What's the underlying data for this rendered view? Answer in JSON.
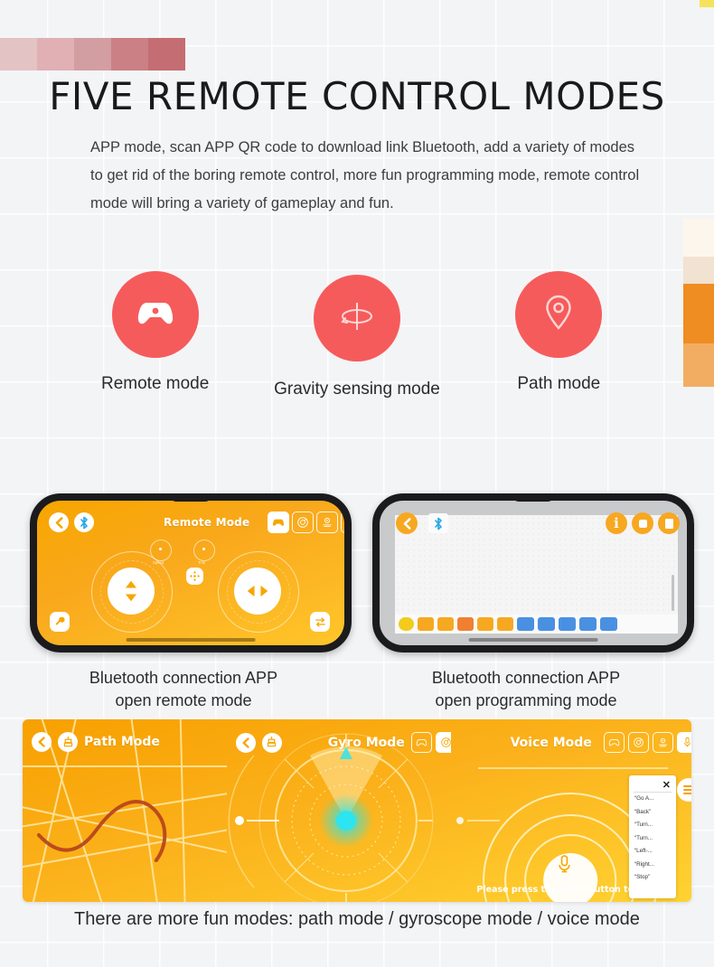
{
  "page": {
    "heading": "FIVE REMOTE CONTROL MODES",
    "lead_paragraph": "APP mode, scan APP QR code to download link Bluetooth, add a variety of modes to get rid of the boring remote control, more fun programming mode, remote control mode will bring a variety of gameplay and fun.",
    "bottom_caption": "There are more fun modes: path mode / gyroscope mode / voice mode"
  },
  "decor": {
    "top_bar_colors": [
      "#e3c3c4",
      "#e0b0b4",
      "#d39ea1",
      "#ca8084",
      "#c46d72"
    ],
    "right_swatch_colors": [
      "#fdf6ec",
      "#f2e2d2",
      "#f0e1cf",
      "#ef8c22",
      "#f2ad63"
    ],
    "corner_marker_color": "#f5e25a",
    "accent_red": "#f65b5b",
    "accent_orange": "#f7a600",
    "accent_yellow": "#ffd232"
  },
  "modes": [
    {
      "icon": "gamepad-icon",
      "label": "Remote mode"
    },
    {
      "icon": "gyroscope-icon",
      "label": "Gravity sensing mode"
    },
    {
      "icon": "map-pin-icon",
      "label": "Path mode"
    }
  ],
  "phones": [
    {
      "id": "remote",
      "caption_line1": "Bluetooth connection APP",
      "caption_line2": "open remote mode",
      "screen": {
        "title": "Remote Mode",
        "back_icon": "chevron-left-icon",
        "bluetooth_icon": "bluetooth-icon",
        "mode_chips": [
          {
            "icon": "gamepad-icon",
            "selected": true
          },
          {
            "icon": "gyroscope-icon",
            "selected": false
          },
          {
            "icon": "path-icon",
            "selected": false
          },
          {
            "icon": "microphone-icon",
            "selected": false
          }
        ],
        "knob_left_label": "Speed",
        "knob_right_label": "Trim",
        "center_button_icon": "four-way-arrow-icon",
        "left_joystick_icon": "up-down-arrow-icon",
        "right_joystick_icon": "left-right-arrow-icon",
        "tool_button_icon": "wrench-icon",
        "swap_button_icon": "swap-arrows-icon"
      }
    },
    {
      "id": "programming",
      "caption_line1": "Bluetooth connection APP",
      "caption_line2": "open programming mode",
      "screen": {
        "back_icon": "chevron-left-icon",
        "bluetooth_icon": "bluetooth-icon",
        "top_right_icons": [
          "info-icon",
          "stop-icon",
          "save-icon"
        ],
        "block_palette": [
          {
            "color": "#f2cb1d",
            "name": "start-flag-block"
          },
          {
            "color": "#f7a821",
            "name": "loop-block"
          },
          {
            "color": "#f7a821",
            "name": "repeat-block"
          },
          {
            "color": "#f08030",
            "name": "stop-block"
          },
          {
            "color": "#f7a821",
            "name": "timer-block"
          },
          {
            "color": "#f7a821",
            "name": "sound-block"
          },
          {
            "color": "#4a90e2",
            "name": "move-up-block"
          },
          {
            "color": "#4a90e2",
            "name": "move-down-block"
          },
          {
            "color": "#4a90e2",
            "name": "move-left-block"
          },
          {
            "color": "#4a90e2",
            "name": "move-right-block"
          },
          {
            "color": "#4a90e2",
            "name": "rotate-block"
          }
        ]
      }
    }
  ],
  "banner": {
    "panes": [
      {
        "id": "path",
        "title": "Path Mode",
        "back_icon": "chevron-left-icon",
        "robot_icon": "robot-icon",
        "chips": []
      },
      {
        "id": "gyro",
        "title": "Gyro Mode",
        "back_icon": "chevron-left-icon",
        "robot_icon": "robot-icon",
        "chips": [
          {
            "icon": "gamepad-icon",
            "selected": false
          },
          {
            "icon": "gyroscope-icon",
            "selected": true
          },
          {
            "icon": "path-icon",
            "selected": false
          },
          {
            "icon": "microphone-icon",
            "selected": false
          }
        ]
      },
      {
        "id": "voice",
        "title": "Voice Mode",
        "chips": [
          {
            "icon": "gamepad-icon",
            "selected": false
          },
          {
            "icon": "gyroscope-icon",
            "selected": false
          },
          {
            "icon": "path-icon",
            "selected": false
          },
          {
            "icon": "microphone-icon",
            "selected": true
          }
        ],
        "hint": "Please press the voice button to speak",
        "mic_button_icon": "microphone-icon",
        "command_panel": {
          "close_icon": "close-icon",
          "menu_icon": "hamburger-icon",
          "commands": [
            "“Go A...",
            "“Back”",
            "“Turn...",
            "“Turn...",
            "“Left-...",
            "“Right...",
            "“Stop”"
          ]
        }
      }
    ]
  }
}
